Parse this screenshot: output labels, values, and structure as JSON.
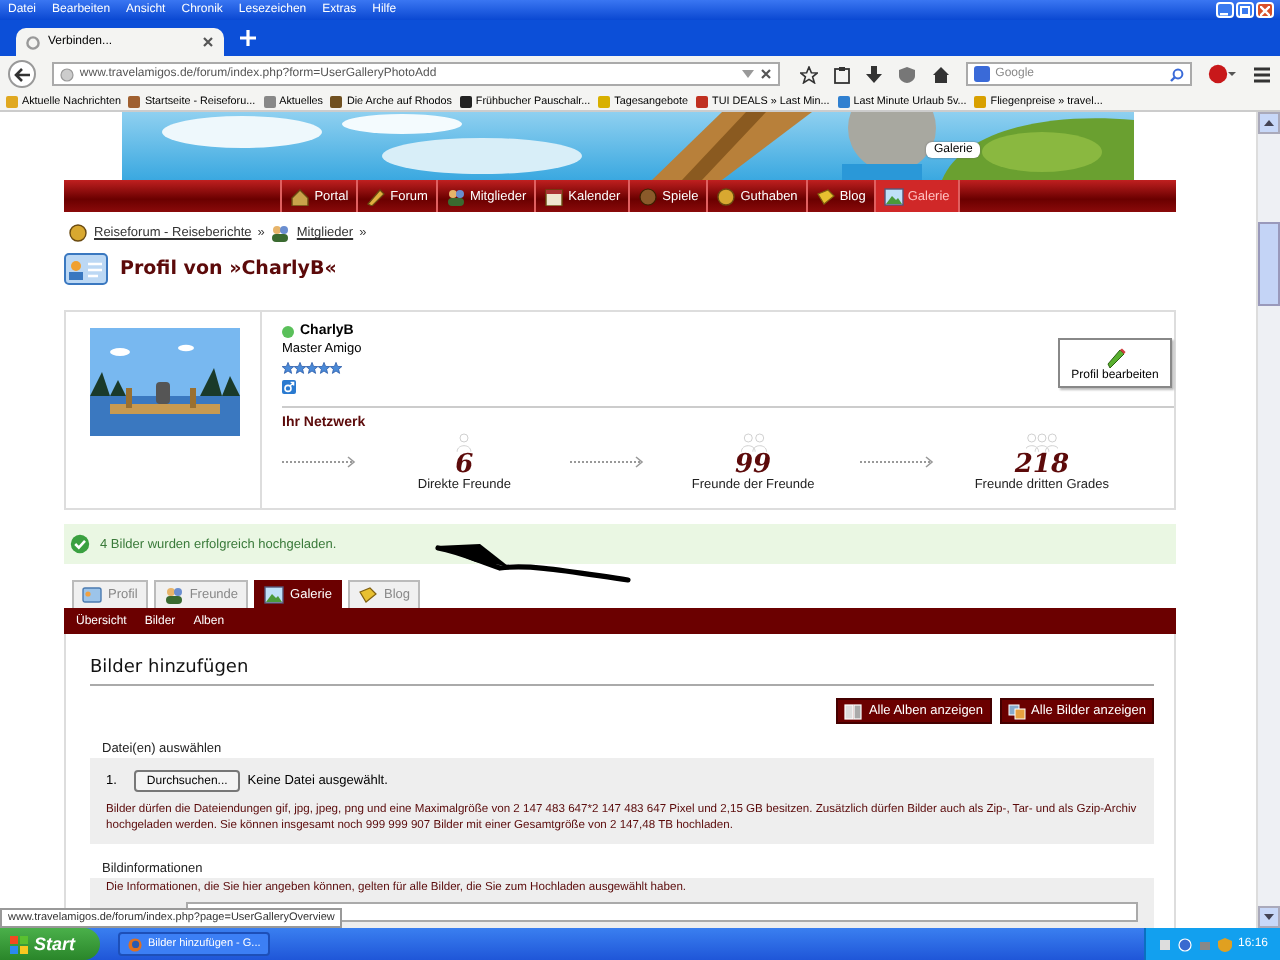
{
  "browser": {
    "menu": [
      "Datei",
      "Bearbeiten",
      "Ansicht",
      "Chronik",
      "Lesezeichen",
      "Extras",
      "Hilfe"
    ],
    "tabs": [
      {
        "label": "Verbinden...",
        "selected": true
      }
    ],
    "url": "www.travelamigos.de/forum/index.php?form=UserGalleryPhotoAdd",
    "search": {
      "placeholder": "Google"
    },
    "bookmarks": [
      "Aktuelle Nachrichten",
      "Startseite - Reiseforu...",
      "Aktuelles",
      "Die Arche auf Rhodos",
      "Frühbucher Pauschalr...",
      "Tagesangebote",
      "TUI DEALS » Last Min...",
      "Last Minute Urlaub 5v...",
      "Fliegenpreise » travel..."
    ]
  },
  "site": {
    "banner_tooltip": "Galerie",
    "nav": [
      {
        "label": "Portal",
        "selected": false
      },
      {
        "label": "Forum",
        "selected": false
      },
      {
        "label": "Mitglieder",
        "selected": false
      },
      {
        "label": "Kalender",
        "selected": false
      },
      {
        "label": "Spiele",
        "selected": false
      },
      {
        "label": "Guthaben",
        "selected": false
      },
      {
        "label": "Blog",
        "selected": false
      },
      {
        "label": "Galerie",
        "selected": true
      }
    ],
    "breadcrumb": [
      "Reiseforum - Reiseberichte",
      "Mitglieder"
    ],
    "breadcrumb_separator": "»",
    "title": "Profil von »CharlyB«"
  },
  "profile": {
    "name": "CharlyB",
    "online": true,
    "rank": "Master Amigo",
    "stars": 5,
    "edit_button": "Profil bearbeiten",
    "network_title": "Ihr Netzwerk",
    "network": [
      {
        "count": "6",
        "label": "Direkte Freunde"
      },
      {
        "count": "99",
        "label": "Freunde der Freunde"
      },
      {
        "count": "218",
        "label": "Freunde dritten Grades"
      }
    ]
  },
  "success_message": "4 Bilder wurden erfolgreich hochgeladen.",
  "tabs": [
    {
      "label": "Profil",
      "selected": false
    },
    {
      "label": "Freunde",
      "selected": false
    },
    {
      "label": "Galerie",
      "selected": true
    },
    {
      "label": "Blog",
      "selected": false
    }
  ],
  "subnav": [
    "Übersicht",
    "Bilder",
    "Alben"
  ],
  "section_title": "Bilder hinzufügen",
  "buttons": [
    "Alle Alben anzeigen",
    "Alle Bilder anzeigen"
  ],
  "file_section": {
    "legend": "Datei(en) auswählen",
    "index": "1.",
    "browse_button": "Durchsuchen...",
    "file_status": "Keine Datei ausgewählt.",
    "note": "Bilder dürfen die Dateiendungen gif, jpg, jpeg, png und eine Maximalgröße von 2 147 483 647*2 147 483 647 Pixel und 2,15 GB besitzen. Zusätzlich dürfen Bilder auch als Zip-, Tar- und als Gzip-Archiv hochgeladen werden. Sie können insgesamt noch 999 999 907 Bilder mit einer Gesamtgröße von 2 147,48 TB hochladen."
  },
  "info_section": {
    "legend": "Bildinformationen",
    "note": "Die Informationen, die Sie hier angeben können, gelten für alle Bilder, die Sie zum Hochladen ausgewählt haben."
  },
  "status_url": "www.travelamigos.de/forum/index.php?page=UserGalleryOverview",
  "taskbar": {
    "start": "Start",
    "tasks": [
      "Bilder hinzufügen - G..."
    ],
    "clock": "16:16"
  }
}
